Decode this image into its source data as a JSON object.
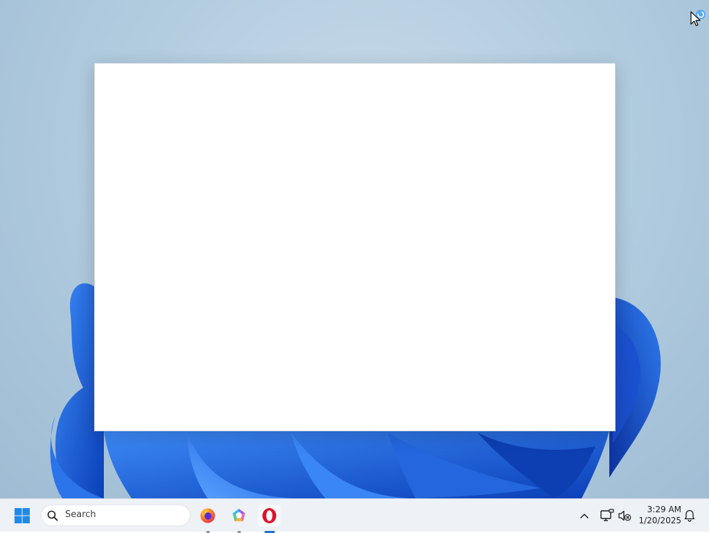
{
  "desktop": {
    "wallpaper": "windows-11-bloom",
    "accent_color": "#1f5fe0"
  },
  "window": {
    "state": "blank-loading"
  },
  "taskbar": {
    "start_icon": "windows-logo-icon",
    "search": {
      "label": "Search",
      "icon": "search-icon"
    },
    "apps": [
      {
        "name": "Firefox",
        "icon": "firefox-icon",
        "running": true,
        "active": false
      },
      {
        "name": "Copilot",
        "icon": "copilot-icon",
        "running": true,
        "active": false
      },
      {
        "name": "Opera",
        "icon": "opera-icon",
        "running": true,
        "active": true
      }
    ],
    "tray": {
      "icons": [
        "chevron-up-icon",
        "network-icon",
        "volume-muted-icon",
        "bell-icon"
      ],
      "time": "3:29 AM",
      "date": "1/20/2025"
    }
  },
  "colors": {
    "taskbar_bg": "#eef1f5",
    "active_indicator": "#1f6fd2",
    "opera_red": "#e0112b"
  }
}
